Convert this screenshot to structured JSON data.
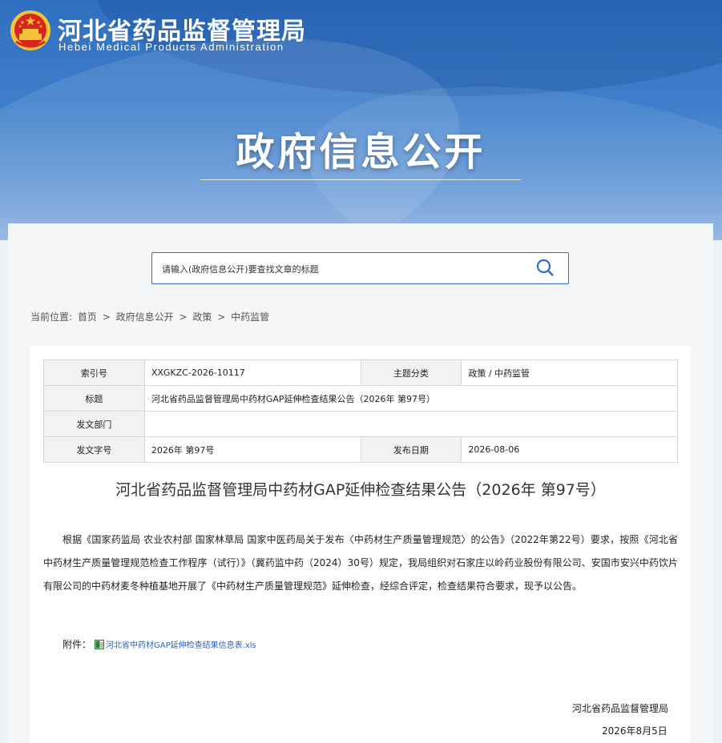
{
  "header": {
    "site_name_cn": "河北省药品监督管理局",
    "site_name_en": "Hebei Medical Products Administration",
    "banner_title": "政府信息公开"
  },
  "search": {
    "placeholder": "请输入(政府信息公开)要查找文章的标题"
  },
  "breadcrumb": {
    "prefix": "当前位置:",
    "items": [
      "首页",
      "政府信息公开",
      "政策",
      "中药监管"
    ],
    "separator": ">"
  },
  "info_table": {
    "index_label": "索引号",
    "index_value": "XXGKZC-2026-10117",
    "category_label": "主题分类",
    "category_value": "政策 / 中药监管",
    "title_label": "标题",
    "title_value": "河北省药品监督管理局中药材GAP延伸检查结果公告（2026年 第97号）",
    "dept_label": "发文部门",
    "dept_value": "",
    "docno_label": "发文字号",
    "docno_value": "2026年 第97号",
    "date_label": "发布日期",
    "date_value": "2026-08-06"
  },
  "article": {
    "title": "河北省药品监督管理局中药材GAP延伸检查结果公告（2026年 第97号）",
    "body": "根据《国家药监局 农业农村部 国家林草局 国家中医药局关于发布〈中药材生产质量管理规范〉的公告》（2022年第22号）要求，按照《河北省中药材生产质量管理规范检查工作程序（试行）》（冀药监中药（2024）30号）规定，我局组织对石家庄以岭药业股份有限公司、安国市安兴中药饮片有限公司的中药材麦冬种植基地开展了《中药材生产质量管理规范》延伸检查，经综合评定，检查结果符合要求，现予以公告。",
    "attachment_label": "附件：",
    "attachment_name": "河北省中药材GAP延伸检查结果信息表.xls",
    "sign_org": "河北省药品监督管理局",
    "sign_date": "2026年8月5日"
  },
  "icons": {
    "emblem": "national-emblem-icon",
    "search": "search-icon",
    "attachment": "excel-file-icon"
  },
  "colors": {
    "banner_blue": "#2f6fbf",
    "link_blue": "#2a62b9",
    "emblem_red": "#d8261d",
    "emblem_gold": "#f3c33b"
  }
}
